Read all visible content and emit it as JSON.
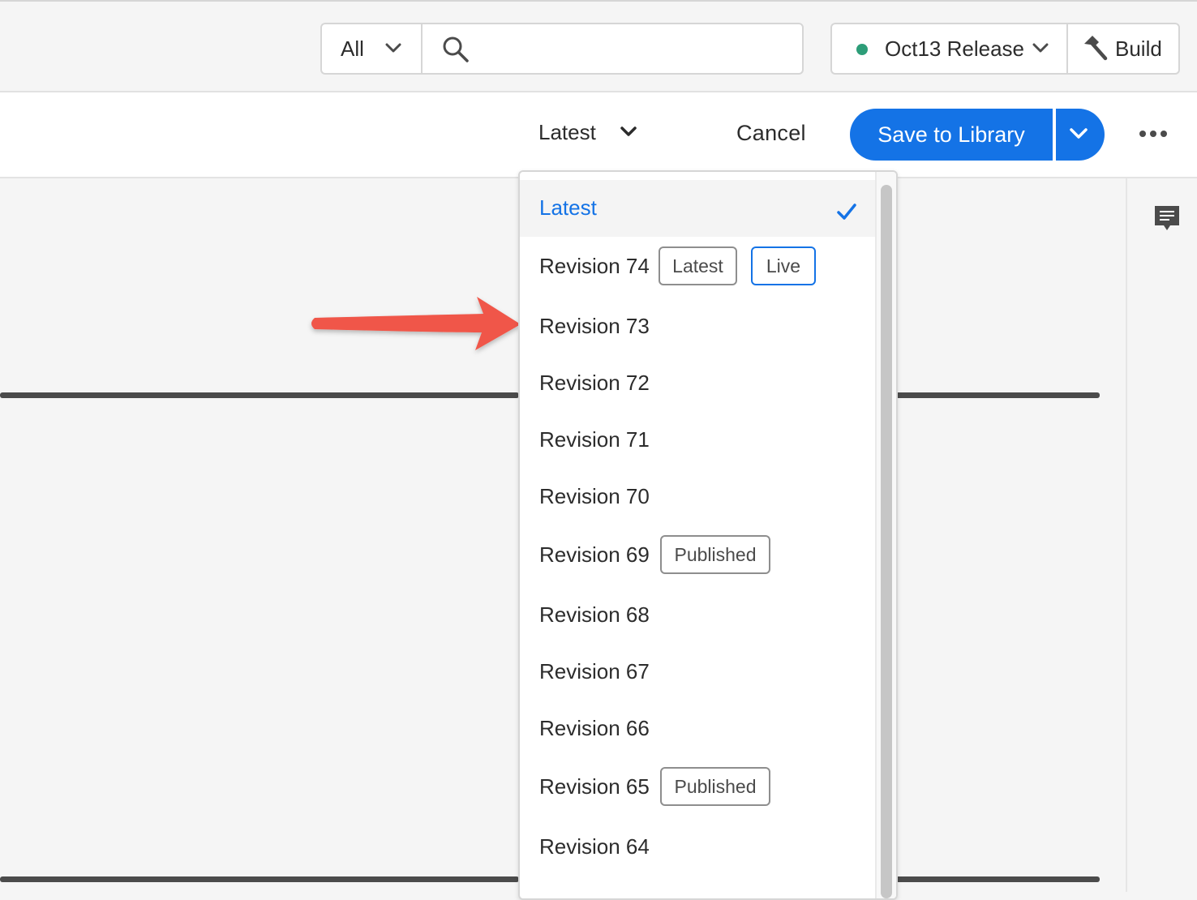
{
  "topbar": {
    "scope_label": "All",
    "search_placeholder": "",
    "release_label": "Oct13 Release",
    "release_status_color": "#2d9d78",
    "build_label": "Build"
  },
  "actionbar": {
    "version_label": "Latest",
    "cancel_label": "Cancel",
    "save_label": "Save to Library"
  },
  "colors": {
    "accent": "#1473e6"
  },
  "revision_menu": {
    "items": [
      {
        "label": "Latest",
        "selected": true,
        "tags": []
      },
      {
        "label": "Revision 74",
        "tags": [
          "Latest",
          "Live"
        ]
      },
      {
        "label": "Revision 73",
        "tags": []
      },
      {
        "label": "Revision 72",
        "tags": []
      },
      {
        "label": "Revision 71",
        "tags": []
      },
      {
        "label": "Revision 70",
        "tags": []
      },
      {
        "label": "Revision 69",
        "tags": [
          "Published"
        ]
      },
      {
        "label": "Revision 68",
        "tags": []
      },
      {
        "label": "Revision 67",
        "tags": []
      },
      {
        "label": "Revision 66",
        "tags": []
      },
      {
        "label": "Revision 65",
        "tags": [
          "Published"
        ]
      },
      {
        "label": "Revision 64",
        "tags": []
      }
    ]
  }
}
